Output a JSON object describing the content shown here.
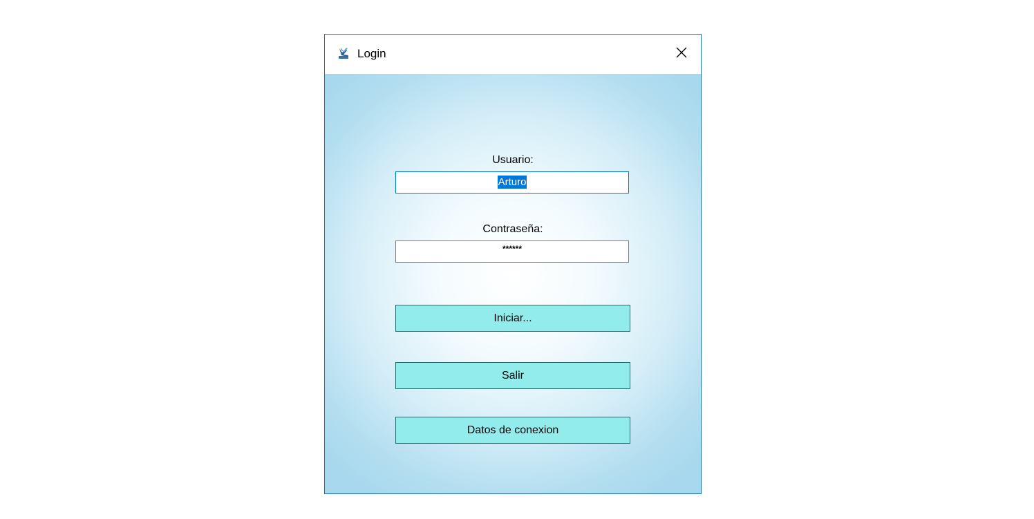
{
  "window": {
    "title": "Login",
    "close_glyph": "✕",
    "app_icon": "app-login-icon",
    "close_icon": "close-icon"
  },
  "form": {
    "user_label": "Usuario:",
    "user_value": "Arturo",
    "password_label": "Contraseña:",
    "password_value": "******"
  },
  "buttons": {
    "start_label": "Iniciar...",
    "exit_label": "Salir",
    "connection_label": "Datos de conexion"
  },
  "colors": {
    "window_border": "#1f6fb5",
    "button_fill": "#93ecec",
    "button_border": "#1f6b6b",
    "selection": "#0078d7",
    "background_edge": "#a8d8ee"
  }
}
